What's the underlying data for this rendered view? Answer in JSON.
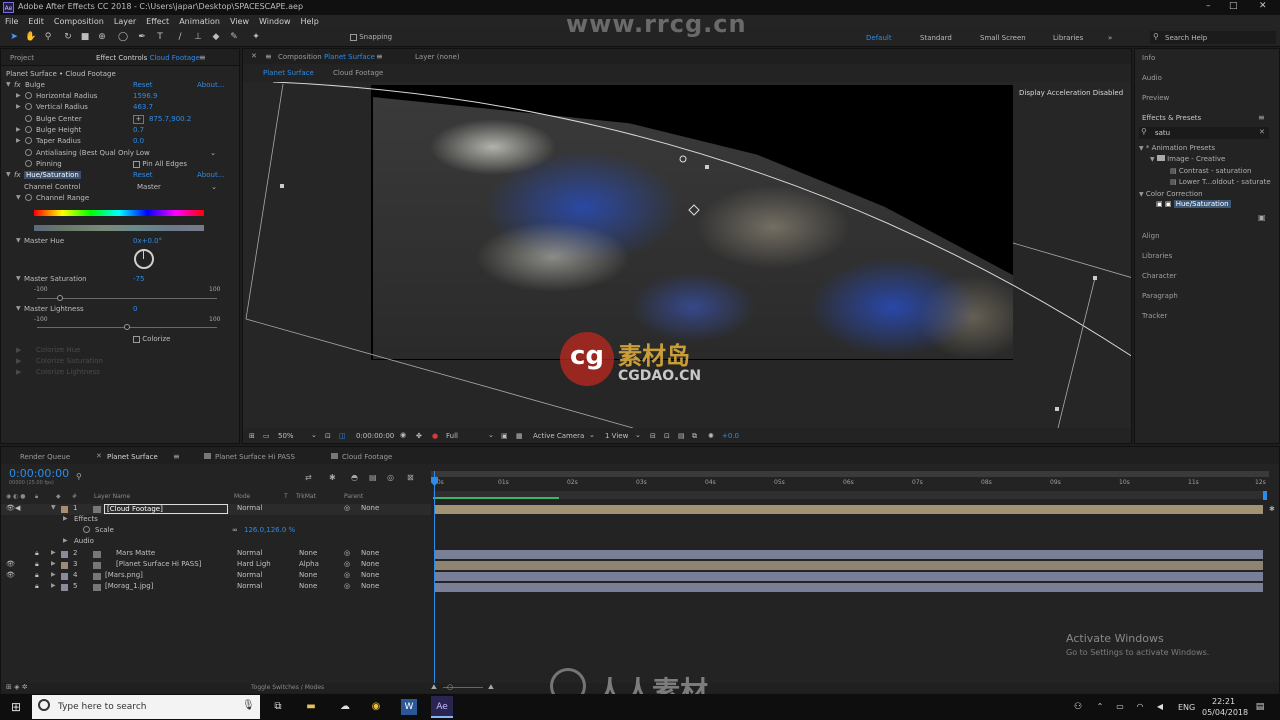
{
  "app": {
    "title": "Adobe After Effects CC 2018 - C:\\Users\\japar\\Desktop\\SPACESCAPE.aep",
    "icon_text": "Ae",
    "window_controls": [
      "–",
      "□",
      "✕"
    ]
  },
  "menu": [
    "File",
    "Edit",
    "Composition",
    "Layer",
    "Effect",
    "Animation",
    "View",
    "Window",
    "Help"
  ],
  "toolbar": {
    "snapping_label": "Snapping",
    "workspaces": [
      "Default",
      "Standard",
      "Small Screen",
      "Libraries"
    ],
    "active_workspace": "Default",
    "search_placeholder": "Search Help"
  },
  "effect_controls": {
    "project_tab": "Project",
    "tab_label": "Effect Controls",
    "tab_layer": "Cloud Footage",
    "subtitle": "Planet Surface • Cloud Footage",
    "bulge": {
      "name": "Bulge",
      "reset": "Reset",
      "about": "About...",
      "horizontal_radius": {
        "label": "Horizontal Radius",
        "value": "1596.9"
      },
      "vertical_radius": {
        "label": "Vertical Radius",
        "value": "463.7"
      },
      "bulge_center": {
        "label": "Bulge Center",
        "value": "875.7,900.2"
      },
      "bulge_height": {
        "label": "Bulge Height",
        "value": "0.7"
      },
      "taper_radius": {
        "label": "Taper Radius",
        "value": "0.0"
      },
      "antialiasing": {
        "label": "Antialiasing (Best Qual Only",
        "value": "Low"
      },
      "pinning": {
        "label": "Pinning",
        "checkbox": "Pin All Edges"
      }
    },
    "hue_sat": {
      "name": "Hue/Saturation",
      "reset": "Reset",
      "about": "About...",
      "channel_control": {
        "label": "Channel Control",
        "value": "Master"
      },
      "channel_range": "Channel Range",
      "master_hue": {
        "label": "Master Hue",
        "value": "0x+0.0°"
      },
      "master_saturation": {
        "label": "Master Saturation",
        "value": "-75",
        "min": "-100",
        "max": "100",
        "level": -75
      },
      "master_lightness": {
        "label": "Master Lightness",
        "value": "0",
        "min": "-100",
        "max": "100",
        "level": 0
      },
      "colorize": "Colorize",
      "disabled": [
        "Colorize Hue",
        "Colorize Saturation",
        "Colorize Lightness"
      ]
    }
  },
  "composition": {
    "tab_prefix": "Composition",
    "tab_name": "Planet Surface",
    "layer_tab": "Layer (none)",
    "breadcrumbs": [
      "Planet Surface",
      "Cloud Footage"
    ],
    "notice": "Display Acceleration Disabled",
    "footer": {
      "zoom": "50%",
      "timecode": "0:00:00:00",
      "resolution": "Full",
      "camera": "Active Camera",
      "views": "1 View",
      "exposure": "+0.0"
    }
  },
  "right_panels": {
    "top": [
      "Info",
      "Audio",
      "Preview"
    ],
    "effects_presets": {
      "title": "Effects & Presets",
      "search": "satu",
      "tree": [
        {
          "label": "* Animation Presets",
          "level": 0
        },
        {
          "label": "Image - Creative",
          "level": 1
        },
        {
          "label": "Contrast - saturation",
          "level": 2
        },
        {
          "label": "Lower T...oldout - saturate",
          "level": 2
        },
        {
          "label": "Color Correction",
          "level": 0
        },
        {
          "label": "Hue/Saturation",
          "level": 1
        }
      ]
    },
    "bottom": [
      "Align",
      "Libraries",
      "Character",
      "Paragraph",
      "Tracker"
    ]
  },
  "timeline": {
    "tabs": [
      "Render Queue",
      "Planet Surface",
      "Planet Surface Hi PASS",
      "Cloud Footage"
    ],
    "active_tab": "Planet Surface",
    "timecode": "0:00:00:00",
    "frame_info": "00000 (25.00 fps)",
    "columns": {
      "num": "#",
      "layer_name": "Layer Name",
      "mode": "Mode",
      "t": "T",
      "trkmat": "TrkMat",
      "parent": "Parent"
    },
    "layers": [
      {
        "num": "1",
        "name": "[Cloud Footage]",
        "mode": "Normal",
        "trkmat": "",
        "parent": "None"
      },
      {
        "num": "2",
        "name": "Mars Matte",
        "mode": "Normal",
        "trkmat": "None",
        "parent": "None"
      },
      {
        "num": "3",
        "name": "[Planet Surface Hi PASS]",
        "mode": "Hard Ligh",
        "trkmat": "Alpha",
        "parent": "None"
      },
      {
        "num": "4",
        "name": "[Mars.png]",
        "mode": "Normal",
        "trkmat": "None",
        "parent": "None"
      },
      {
        "num": "5",
        "name": "[Morag_1.jpg]",
        "mode": "Normal",
        "trkmat": "None",
        "parent": "None"
      }
    ],
    "sub_rows": {
      "effects": "Effects",
      "scale": "Scale",
      "scale_value": "126.0,126.0 %",
      "audio": "Audio"
    },
    "ruler": [
      "00s",
      "01s",
      "02s",
      "03s",
      "04s",
      "05s",
      "06s",
      "07s",
      "08s",
      "09s",
      "10s",
      "11s",
      "12s"
    ],
    "footer": "Toggle Switches / Modes"
  },
  "activate_windows": {
    "title": "Activate Windows",
    "subtitle": "Go to Settings to activate Windows."
  },
  "watermark": {
    "url": "www.rrcg.cn",
    "cg_logo": "cg",
    "cg_cn": "素材岛",
    "cg_site": "CGDAO.CN",
    "bottom": "人人素材"
  },
  "taskbar": {
    "search_placeholder": "Type here to search",
    "lang": "ENG",
    "time": "22:21",
    "date": "05/04/2018"
  },
  "colors": {
    "accent": "#2d8ceb",
    "bg": "#1d1d1d",
    "panel": "#232323"
  }
}
